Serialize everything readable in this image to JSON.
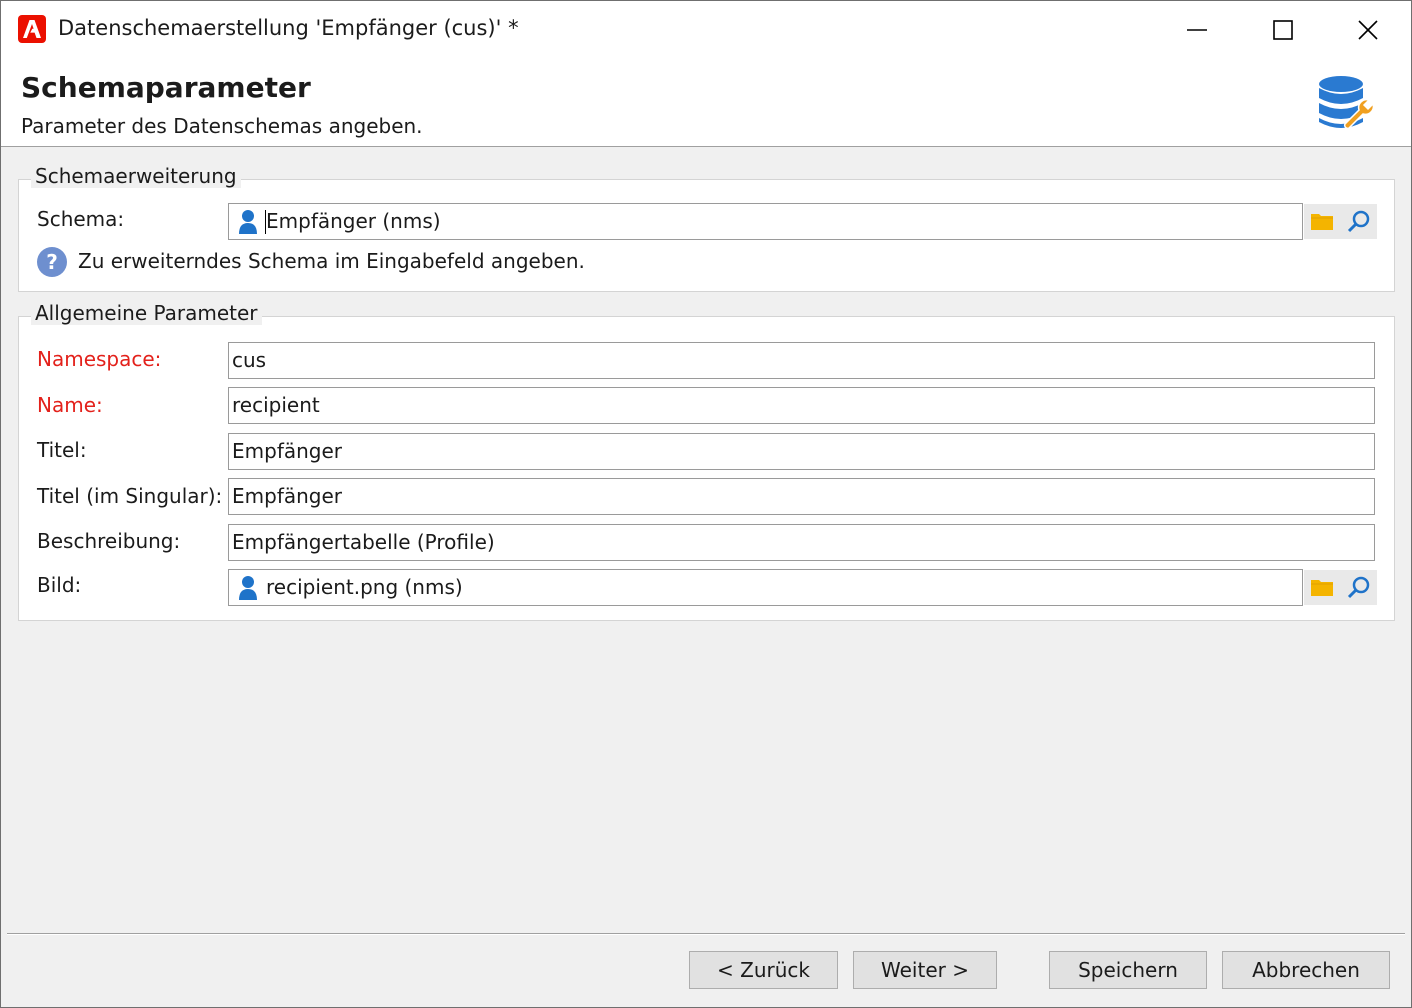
{
  "window": {
    "title": "Datenschemaerstellung 'Empfänger (cus)' *"
  },
  "header": {
    "title": "Schemaparameter",
    "subtitle": "Parameter des Datenschemas angeben."
  },
  "schema_extension": {
    "legend": "Schemaerweiterung",
    "schema_label": "Schema:",
    "schema_value": "Empfänger (nms)",
    "hint": "Zu erweiterndes Schema im Eingabefeld angeben."
  },
  "general_parameters": {
    "legend": "Allgemeine Parameter",
    "namespace_label": "Namespace:",
    "namespace_value": "cus",
    "name_label": "Name:",
    "name_value": "recipient",
    "title_label": "Titel:",
    "title_value": "Empfänger",
    "singular_label": "Titel (im Singular):",
    "singular_value": "Empfänger",
    "description_label": "Beschreibung:",
    "description_value": "Empfängertabelle (Profile)",
    "image_label": "Bild:",
    "image_value": "recipient.png (nms)"
  },
  "buttons": {
    "back": "< Zurück",
    "next": "Weiter >",
    "save": "Speichern",
    "cancel": "Abbrechen"
  },
  "colors": {
    "required_label": "#e3211b",
    "adobe_red": "#eb1000",
    "folder": "#f4b400",
    "link_blue": "#1f73c9"
  },
  "icons": [
    "adobe-logo-icon",
    "minimize-icon",
    "maximize-icon",
    "close-icon",
    "database-wrench-icon",
    "user-icon",
    "folder-icon",
    "search-icon",
    "help-icon"
  ]
}
